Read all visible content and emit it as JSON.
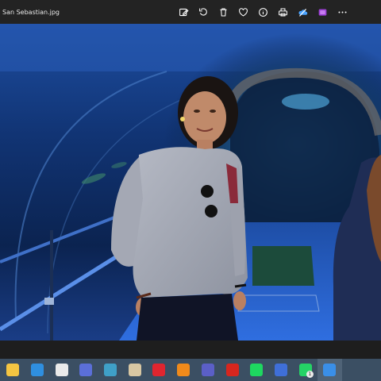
{
  "titlebar": {
    "file_name": "San Sebastian.jpg",
    "tools": [
      {
        "name": "edit-image-icon"
      },
      {
        "name": "rotate-icon"
      },
      {
        "name": "delete-icon"
      },
      {
        "name": "favorite-heart-icon"
      },
      {
        "name": "info-icon"
      },
      {
        "name": "print-icon"
      },
      {
        "name": "onedrive-icon"
      },
      {
        "name": "clipchamp-icon"
      },
      {
        "name": "more-options-icon"
      }
    ]
  },
  "photo": {
    "subject": "aquarium-tunnel-photo"
  },
  "taskbar": {
    "apps": [
      {
        "name": "file-explorer-icon",
        "color": "#f4c542",
        "label": ""
      },
      {
        "name": "mail-icon",
        "color": "#2f8fe0",
        "label": ""
      },
      {
        "name": "microsoft-store-icon",
        "color": "#eaeaea",
        "label": ""
      },
      {
        "name": "remote-desktop-icon",
        "color": "#5b6fd8",
        "label": ""
      },
      {
        "name": "network-globe-icon",
        "color": "#3fa0c8",
        "label": ""
      },
      {
        "name": "paint-icon",
        "color": "#d8c7a3",
        "label": ""
      },
      {
        "name": "opera-icon",
        "color": "#e0252f",
        "label": ""
      },
      {
        "name": "vlc-icon",
        "color": "#f08a1b",
        "label": ""
      },
      {
        "name": "teams-icon",
        "color": "#5b5fc7",
        "label": ""
      },
      {
        "name": "acrobat-icon",
        "color": "#d7261e",
        "label": ""
      },
      {
        "name": "spotify-icon",
        "color": "#1ed760",
        "label": ""
      },
      {
        "name": "document-app-icon",
        "color": "#3f6fd8",
        "label": ""
      },
      {
        "name": "whatsapp-icon",
        "color": "#25d366",
        "label": "",
        "badge": "1"
      },
      {
        "name": "photos-icon",
        "color": "#3a8fe8",
        "label": "",
        "active": true
      }
    ]
  }
}
